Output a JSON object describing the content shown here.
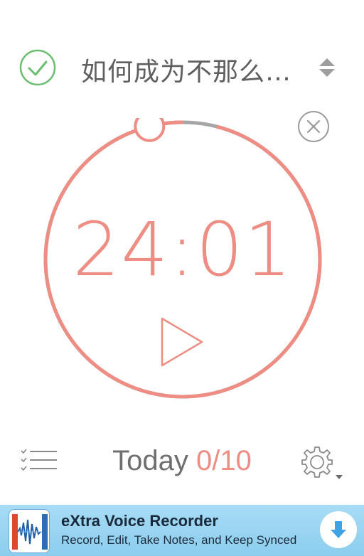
{
  "header": {
    "task_title": "如何成为不那么…",
    "check_icon": "check-circle-icon",
    "sort_icon": "sort-updown-icon"
  },
  "timer": {
    "time": "24:01",
    "progress": 0.04,
    "close_icon": "close-circle-icon",
    "play_icon": "play-icon"
  },
  "footer": {
    "list_icon": "checklist-icon",
    "today_label": "Today",
    "today_count": "0/10",
    "settings_icon": "gear-icon"
  },
  "ad": {
    "title": "eXtra Voice Recorder",
    "subtitle": "Record, Edit, Take Notes, and Keep Synced",
    "download_icon": "download-arrow-icon"
  },
  "colors": {
    "accent": "#ee8d83",
    "check_green": "#6bbd6f",
    "track_gray": "#a6a6a6",
    "text_gray": "#6f6f6f",
    "ad_bg": "#9fd6f3"
  }
}
